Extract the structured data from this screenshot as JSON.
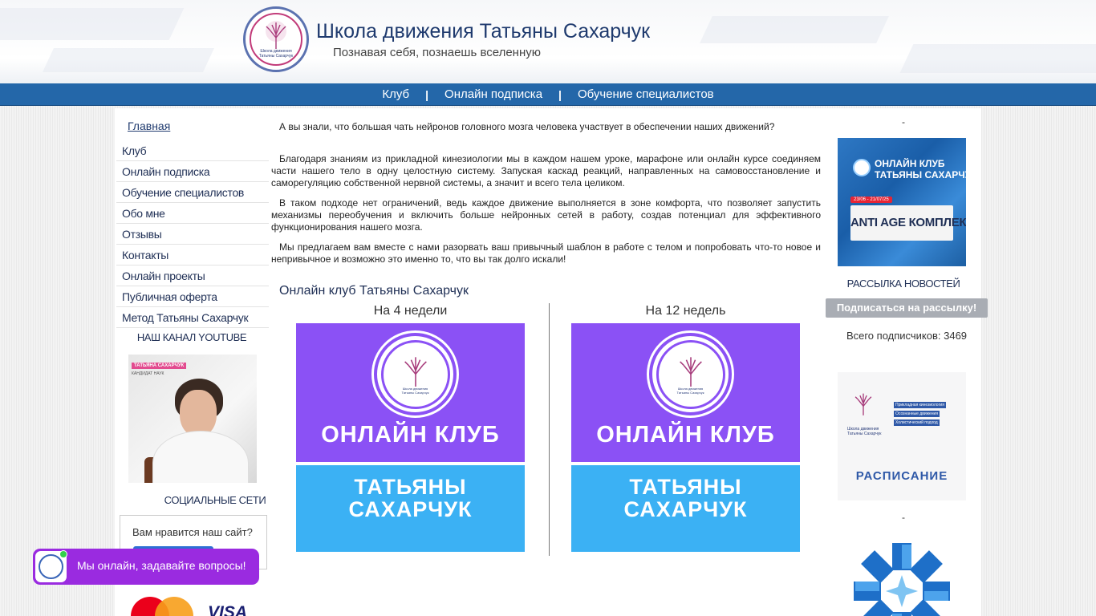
{
  "header": {
    "site_title": "Школа движения Татьяны Сахарчук",
    "slogan": "Познавая себя, познаешь вселенную",
    "logo_text_1": "Школа движения",
    "logo_text_2": "Татьяны Сахарчук"
  },
  "topnav": {
    "items": [
      "Клуб",
      "Онлайн подписка",
      "Обучение специалистов"
    ],
    "separator": "|"
  },
  "left": {
    "home": "Главная",
    "menu": [
      "Клуб",
      "Онлайн подписка",
      "Обучение специалистов",
      "Обо мне",
      "Отзывы",
      "Контакты",
      "Онлайн проекты",
      "Публичная оферта",
      "Метод Татьяны Сахарчук"
    ],
    "youtube_title": "НАШ КАНАЛ YOUTUBE",
    "youtube_badge": "ТАТЬЯНА САХАРЧУК",
    "youtube_sub": "КАНДИДАТ НАУК",
    "social_title": "СОЦИАЛЬНЫЕ СЕТИ",
    "like_question": "Вам нравится наш сайт?",
    "visa": "VISA"
  },
  "center": {
    "paragraphs": [
      "А вы знали, что большая чать нейронов головного мозга человека участвует в обеспечении наших движений?",
      "Благодаря знаниям из прикладной кинезиологии мы в каждом нашем уроке, марафоне или онлайн курсе соединяем части нашего тело в одну целостную систему. Запуская каскад реакций, направленных на самовосстановление и саморегуляцию собственной нервной системы, а значит и всего тела целиком.",
      "В таком подходе нет ограничений, ведь каждое движение выполняется в зоне комфорта, что позволяет запустить механизмы переобучения и включить больше нейронных сетей в работу, создав потенциал для эффективного функционирования нашего мозга.",
      "Мы предлагаем вам вместе с нами разорвать ваш привычный шаблон в работе с телом и попробовать что-то новое и непривычное и возможно это именно то, что вы так долго искали!"
    ],
    "club_title": "Онлайн клуб Татьяны Сахарчук",
    "plans": [
      {
        "label": "На 4 недели",
        "line1": "ОНЛАЙН КЛУБ",
        "line2": "ТАТЬЯНЫ",
        "line3": "САХАРЧУК",
        "logo_1": "Школа движения",
        "logo_2": "Татьяны Сахарчук"
      },
      {
        "label": "На 12 недель",
        "line1": "ОНЛАЙН КЛУБ",
        "line2": "ТАТЬЯНЫ",
        "line3": "САХАРЧУК",
        "logo_1": "Школа движения",
        "logo_2": "Татьяны Сахарчук"
      }
    ]
  },
  "right": {
    "dash": "-",
    "promo": {
      "title_1": "ОНЛАЙН КЛУБ",
      "title_2": "ТАТЬЯНЫ САХАРЧУК",
      "dates": "23/06 - 21/07/25",
      "name": "ANTI AGE КОМПЛЕКС"
    },
    "news_title": "РАССЫЛКА НОВОСТЕЙ",
    "subscribe_label": "Подписаться на рассылку!",
    "subscribers": "Всего подписчиков: 3469",
    "schedule": {
      "tags": [
        "Прикладная кинезиология",
        "Осознанные движения",
        "Холистический подход"
      ],
      "brand_1": "Школа движения",
      "brand_2": "Татьяны Сахарчук",
      "label": "РАСПИСАНИЕ"
    }
  },
  "chat": {
    "text": "Мы онлайн, задавайте вопросы!"
  },
  "colors": {
    "nav_blue": "#2467a9",
    "title_blue": "#1f3a6e",
    "club_purple": "#8b51f5",
    "club_blue": "#3bb1f4",
    "chat_purple": "#9a2be0"
  }
}
